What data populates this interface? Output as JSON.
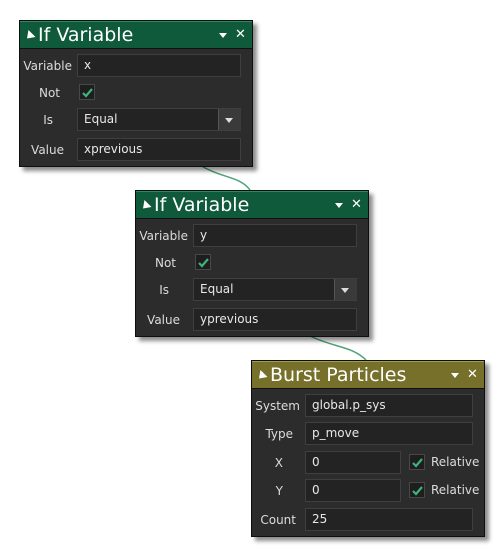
{
  "colors": {
    "green_header": "#0f5a3a",
    "olive_header": "#76702a",
    "node_body": "#2c2c2c",
    "field_bg": "#232323",
    "check_mark": "#3fb37a",
    "connector": "#4fa37a"
  },
  "node1": {
    "title": "If Variable",
    "variable_label": "Variable",
    "variable_value": "x",
    "not_label": "Not",
    "not_checked": true,
    "is_label": "Is",
    "is_value": "Equal",
    "value_label": "Value",
    "value_value": "xprevious"
  },
  "node2": {
    "title": "If Variable",
    "variable_label": "Variable",
    "variable_value": "y",
    "not_label": "Not",
    "not_checked": true,
    "is_label": "Is",
    "is_value": "Equal",
    "value_label": "Value",
    "value_value": "yprevious"
  },
  "node3": {
    "title": "Burst Particles",
    "system_label": "System",
    "system_value": "global.p_sys",
    "type_label": "Type",
    "type_value": "p_move",
    "x_label": "X",
    "x_value": "0",
    "x_relative_label": "Relative",
    "x_relative_checked": true,
    "y_label": "Y",
    "y_value": "0",
    "y_relative_label": "Relative",
    "y_relative_checked": true,
    "count_label": "Count",
    "count_value": "25"
  },
  "icons": {
    "collapse": "collapse-arrow-icon",
    "menu": "dropdown-menu-icon",
    "close": "close-icon",
    "check": "checkmark-icon"
  }
}
